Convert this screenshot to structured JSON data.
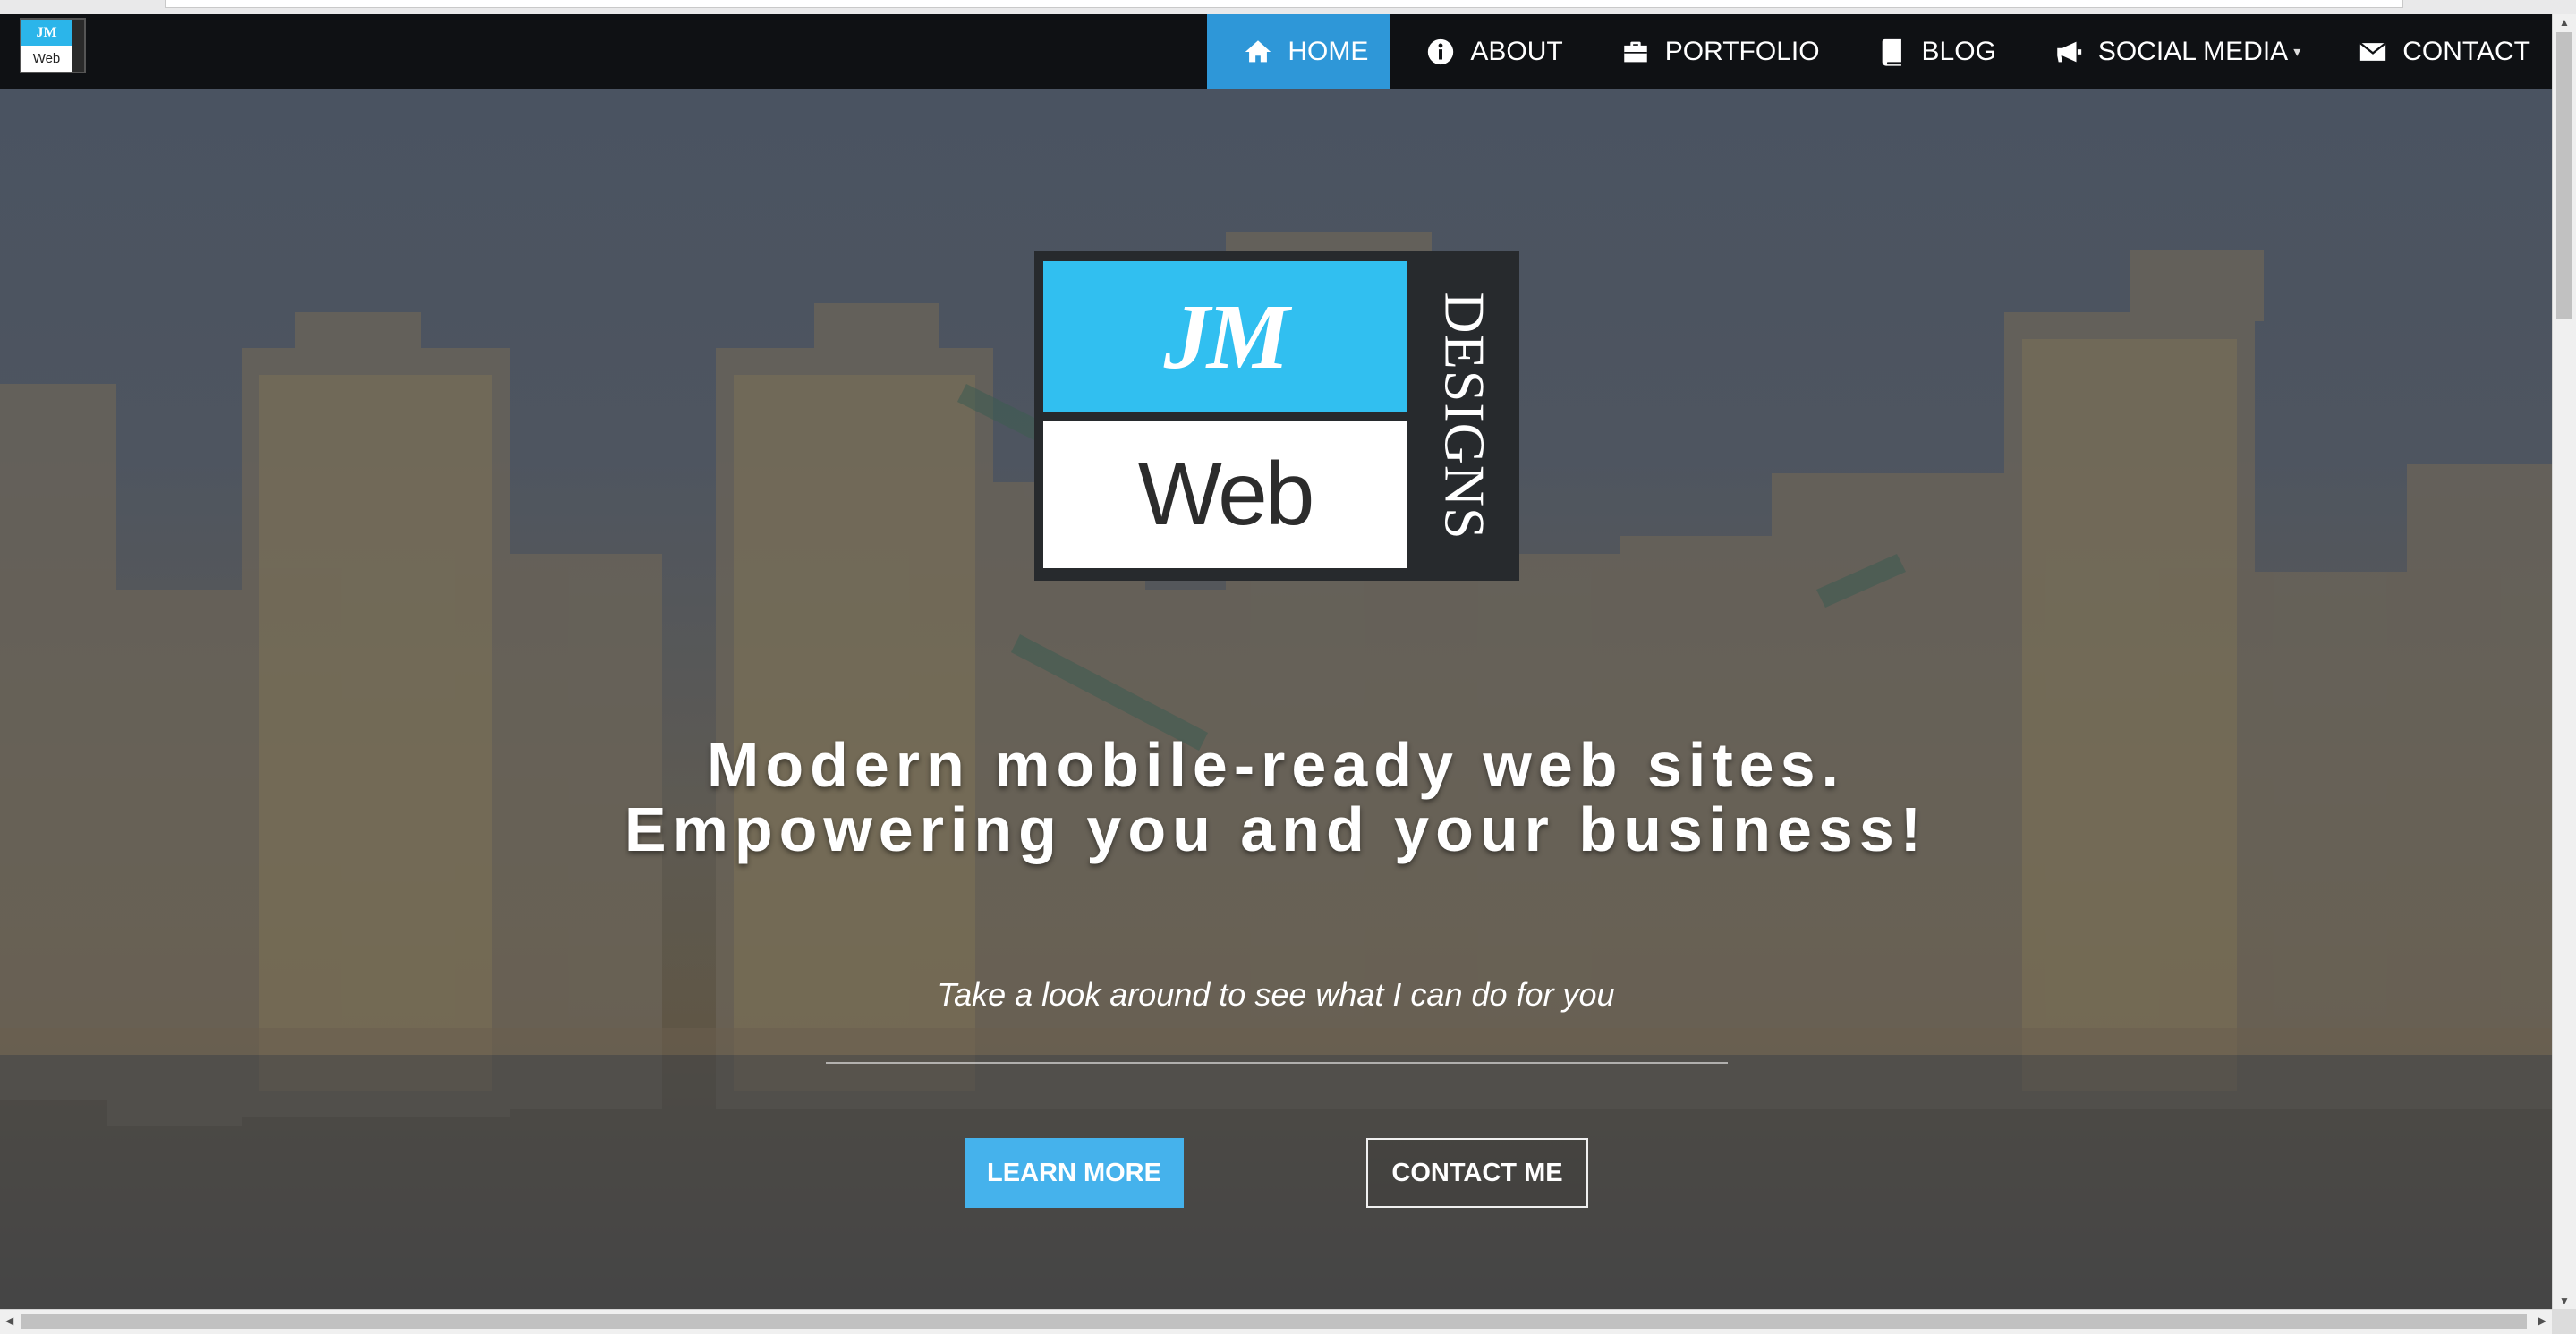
{
  "nav": {
    "items": [
      {
        "label": "HOME",
        "icon": "home-icon",
        "active": true
      },
      {
        "label": "ABOUT",
        "icon": "info-icon",
        "active": false
      },
      {
        "label": "PORTFOLIO",
        "icon": "briefcase-icon",
        "active": false
      },
      {
        "label": "BLOG",
        "icon": "book-icon",
        "active": false
      },
      {
        "label": "SOCIAL MEDIA",
        "icon": "megaphone-icon",
        "active": false,
        "dropdown": true
      },
      {
        "label": "CONTACT",
        "icon": "envelope-icon",
        "active": false
      }
    ]
  },
  "brand": {
    "top": "JM",
    "bottom": "Web"
  },
  "hero": {
    "logo": {
      "top": "JM",
      "bottom": "Web",
      "side": "DESIGNS"
    },
    "headline_line1": "Modern mobile-ready web sites.",
    "headline_line2": "Empowering you and your business!",
    "tagline": "Take a look around to see what I can do for you",
    "learn_more": "LEARN MORE",
    "contact_me": "CONTACT ME"
  },
  "colors": {
    "accent": "#2e97d8",
    "button": "#45b2ec",
    "logo_blue": "#31bff0",
    "nav_bg": "#0f1114"
  }
}
